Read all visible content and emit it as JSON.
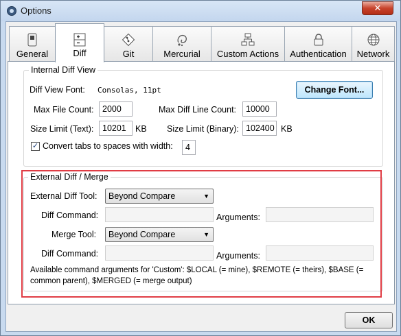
{
  "window": {
    "title": "Options",
    "close_glyph": "✕"
  },
  "tabs": [
    {
      "label": "General",
      "icon": "switch-icon"
    },
    {
      "label": "Diff",
      "icon": "diff-doc-icon",
      "active": true
    },
    {
      "label": "Git",
      "icon": "git-diamond-icon"
    },
    {
      "label": "Mercurial",
      "icon": "mercurial-icon"
    },
    {
      "label": "Custom Actions",
      "icon": "flowchart-icon"
    },
    {
      "label": "Authentication",
      "icon": "padlock-icon"
    },
    {
      "label": "Network",
      "icon": "globe-icon"
    }
  ],
  "internal": {
    "legend": "Internal Diff View",
    "font_label": "Diff View Font:",
    "font_value": "Consolas, 11pt",
    "change_font_button": "Change Font...",
    "max_file_count_label": "Max File Count:",
    "max_file_count_value": "2000",
    "max_diff_line_label": "Max Diff Line Count:",
    "max_diff_line_value": "10000",
    "size_text_label": "Size Limit (Text):",
    "size_text_value": "10201",
    "size_text_unit": "KB",
    "size_binary_label": "Size Limit (Binary):",
    "size_binary_value": "102400",
    "size_binary_unit": "KB",
    "convert_tabs_label": "Convert tabs to spaces with width:",
    "convert_tabs_checked": true,
    "convert_tabs_width": "4"
  },
  "external": {
    "legend": "External Diff / Merge",
    "diff_tool_label": "External Diff Tool:",
    "diff_tool_value": "Beyond Compare",
    "diff_command_label": "Diff Command:",
    "diff_command_value": "",
    "diff_arguments_label": "Arguments:",
    "diff_arguments_value": "",
    "merge_tool_label": "Merge Tool:",
    "merge_tool_value": "Beyond Compare",
    "merge_command_label": "Diff Command:",
    "merge_command_value": "",
    "merge_arguments_label": "Arguments:",
    "merge_arguments_value": "",
    "help_text": "Available command arguments for 'Custom': $LOCAL (= mine), $REMOTE (= theirs), $BASE (= common parent), $MERGED (= merge output)"
  },
  "footer": {
    "ok_button": "OK"
  },
  "colors": {
    "highlight_border": "#e03c44",
    "window_frame": "#c8daef"
  }
}
